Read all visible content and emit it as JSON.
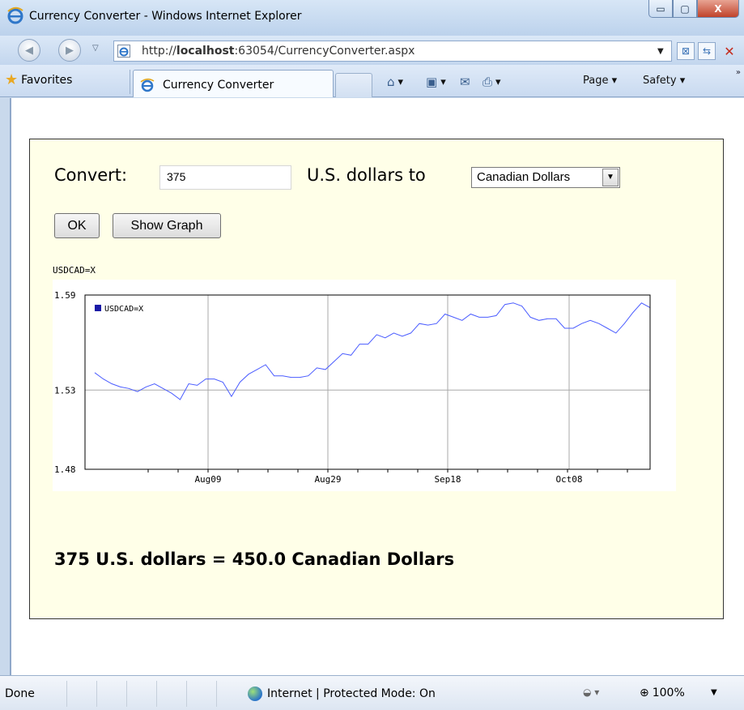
{
  "window": {
    "title": "Currency Converter - Windows Internet Explorer",
    "min_glyph": "▭",
    "max_glyph": "▢",
    "close_glyph": "X"
  },
  "address_bar": {
    "url_prefix": "http://",
    "url_host": "localhost",
    "url_rest": ":63054/CurrencyConverter.aspx"
  },
  "tabbar": {
    "favorites_label": "Favorites",
    "tab_label": "Currency Converter",
    "commands": {
      "page_label": "Page ▾",
      "safety_label": "Safety ▾"
    }
  },
  "form": {
    "convert_label": "Convert:",
    "amount_value": "375",
    "to_label": "U.S. dollars to",
    "currency_selected": "Canadian Dollars",
    "ok_button": "OK",
    "graph_button": "Show Graph"
  },
  "chart_caption": "USDCAD=X",
  "chart_data": {
    "type": "line",
    "title": "USDCAD=X",
    "legend": [
      "USDCAD=X"
    ],
    "legend_placement": "top-left",
    "ylim": [
      1.48,
      1.59
    ],
    "yticks": [
      "1.59",
      "1.53",
      "1.48"
    ],
    "xticks": [
      "Aug09",
      "Aug29",
      "Sep18",
      "Oct08"
    ],
    "grid": true,
    "series": [
      {
        "name": "USDCAD=X",
        "color": "#4a5cff",
        "values": [
          1.541,
          1.537,
          1.534,
          1.532,
          1.531,
          1.529,
          1.532,
          1.534,
          1.531,
          1.528,
          1.524,
          1.534,
          1.533,
          1.537,
          1.537,
          1.535,
          1.526,
          1.535,
          1.54,
          1.543,
          1.546,
          1.539,
          1.539,
          1.538,
          1.538,
          1.539,
          1.544,
          1.543,
          1.548,
          1.553,
          1.552,
          1.559,
          1.559,
          1.565,
          1.563,
          1.566,
          1.564,
          1.566,
          1.572,
          1.571,
          1.572,
          1.578,
          1.576,
          1.574,
          1.578,
          1.576,
          1.576,
          1.577,
          1.584,
          1.585,
          1.583,
          1.576,
          1.574,
          1.575,
          1.575,
          1.569,
          1.569,
          1.572,
          1.574,
          1.572,
          1.569,
          1.566,
          1.572,
          1.579,
          1.585,
          1.582
        ]
      }
    ]
  },
  "result_text": "375 U.S. dollars = 450.0 Canadian Dollars",
  "statusbar": {
    "status": "Done",
    "zone": "Internet | Protected Mode: On",
    "zoom": "100%"
  }
}
